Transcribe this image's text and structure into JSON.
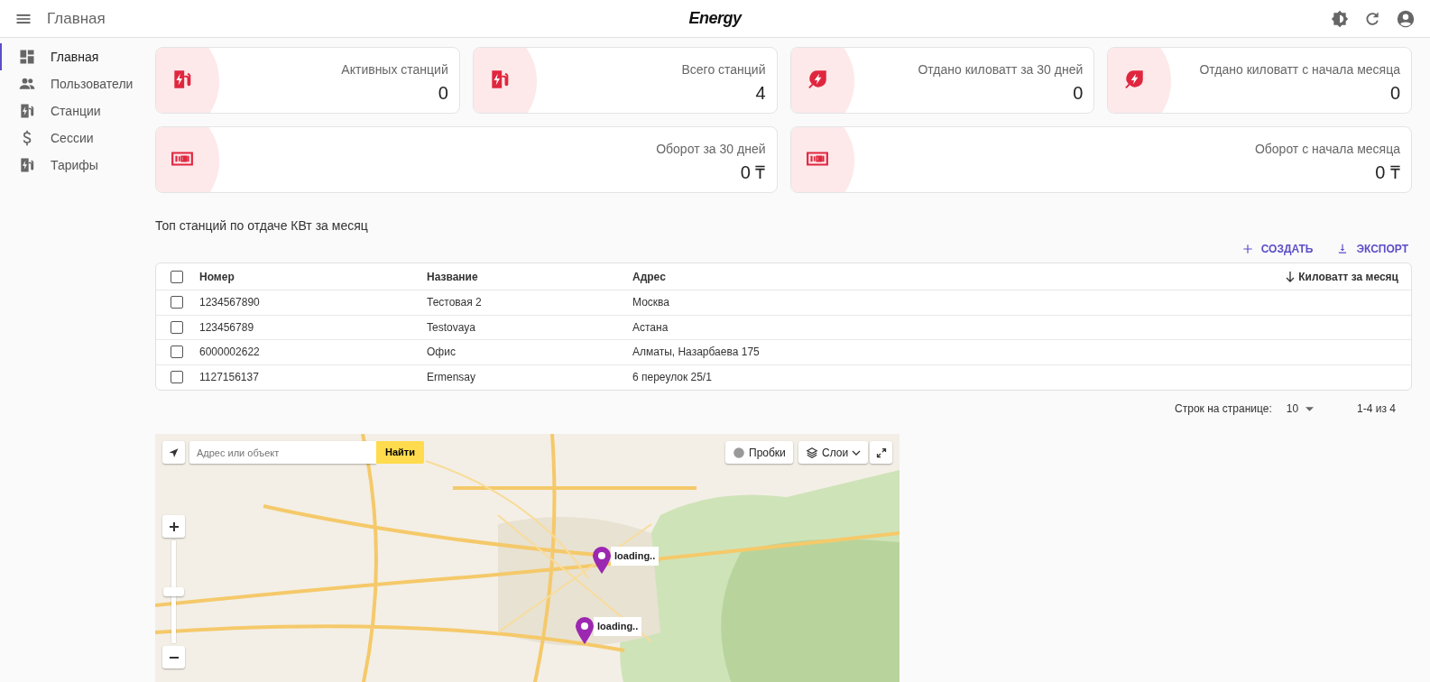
{
  "header": {
    "title": "Главная",
    "logo": "Energy"
  },
  "sidebar": {
    "items": [
      {
        "label": "Главная",
        "kind": "dashboard",
        "selected": true
      },
      {
        "label": "Пользователи",
        "kind": "people",
        "selected": false
      },
      {
        "label": "Станции",
        "kind": "station",
        "selected": false
      },
      {
        "label": "Сессии",
        "kind": "dollar",
        "selected": false
      },
      {
        "label": "Тарифы",
        "kind": "station",
        "selected": false
      }
    ]
  },
  "stats": [
    [
      {
        "label": "Активных станций",
        "value": "0",
        "kind": "station"
      },
      {
        "label": "Всего станций",
        "value": "4",
        "kind": "station"
      },
      {
        "label": "Отдано киловатт за 30 дней",
        "value": "0",
        "kind": "energy"
      },
      {
        "label": "Отдано киловатт с начала месяца",
        "value": "0",
        "kind": "energy"
      }
    ],
    [
      {
        "label": "Оборот за 30 дней",
        "value": "0 ₸",
        "kind": "money"
      },
      {
        "label": "Оборот с начала месяца",
        "value": "0 ₸",
        "kind": "money"
      }
    ]
  ],
  "table": {
    "title": "Топ станций по отдаче КВт за месяц",
    "actions": [
      {
        "label": "СОЗДАТЬ",
        "kind": "plus"
      },
      {
        "label": "ЭКСПОРТ",
        "kind": "download"
      }
    ],
    "select_all": {
      "checked": false
    },
    "columns": [
      "Номер",
      "Название",
      "Адрес",
      "Киловатт за месяц"
    ],
    "rows": [
      {
        "checked": false,
        "cells": [
          "1234567890",
          "Тестовая 2",
          "Москва"
        ]
      },
      {
        "checked": false,
        "cells": [
          "123456789",
          "Testovaya",
          "Астана"
        ]
      },
      {
        "checked": false,
        "cells": [
          "6000002622",
          "Офис",
          "Алматы, Назарбаева 175"
        ]
      },
      {
        "checked": false,
        "cells": [
          "1127156137",
          "Ermensay",
          "6 переулок 25/1"
        ]
      }
    ],
    "pagination": {
      "label": "Строк на странице:",
      "per_page": "10",
      "range": "1-4 из 4"
    }
  },
  "map": {
    "kind": "picture",
    "search": {
      "placeholder": "Адрес или объект",
      "button": "Найти"
    },
    "traffic": "Пробки",
    "layers": "Слои",
    "zoom": {
      "level": 0.5
    },
    "markers": [
      "loading..",
      "loading.."
    ]
  }
}
